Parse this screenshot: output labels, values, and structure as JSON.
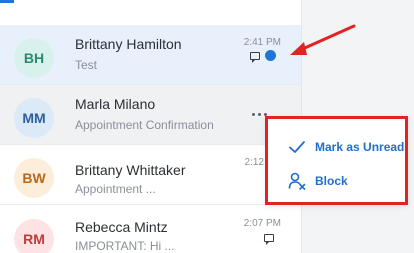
{
  "conversations": [
    {
      "initials": "BH",
      "name": "Brittany Hamilton",
      "preview": "Test",
      "time": "2:41 PM",
      "avatar_bg": "#d8f1ec",
      "avatar_fg": "#2b8a72",
      "state": "selected",
      "unread": true
    },
    {
      "initials": "MM",
      "name": "Marla Milano",
      "preview": "Appointment Confirmation",
      "time": "",
      "avatar_bg": "#dce9f7",
      "avatar_fg": "#2d5fa0",
      "state": "hover",
      "unread": false
    },
    {
      "initials": "BW",
      "name": "Brittany Whittaker",
      "preview": "Appointment ...",
      "time": "2:12",
      "avatar_bg": "#fdeedb",
      "avatar_fg": "#b96916",
      "state": "normal",
      "unread": false
    },
    {
      "initials": "RM",
      "name": "Rebecca Mintz",
      "preview": "IMPORTANT: Hi ...",
      "time": "2:07 PM",
      "avatar_bg": "#fde3e3",
      "avatar_fg": "#c23b3b",
      "state": "normal",
      "unread": false
    }
  ],
  "context_menu": {
    "items": [
      {
        "label": "Mark as Unread",
        "icon": "checkmark-icon"
      },
      {
        "label": "Block",
        "icon": "block-user-icon"
      }
    ]
  },
  "colors": {
    "accent": "#1f75d6",
    "menu_text": "#1f6fcc",
    "highlight_box": "#e32222",
    "annotation_arrow": "#e32222"
  }
}
